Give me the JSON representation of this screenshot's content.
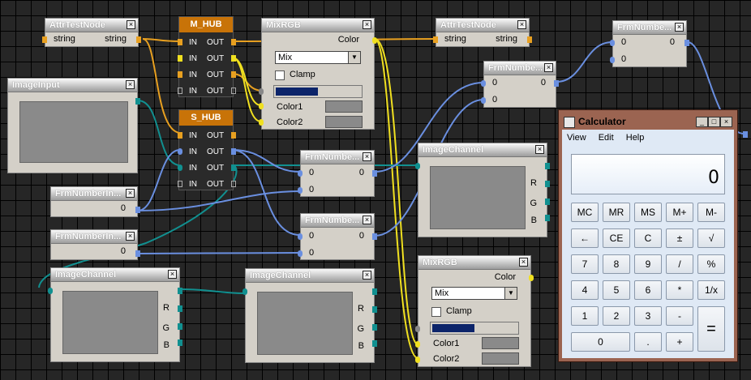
{
  "nodes": {
    "attr1": {
      "title": "AttrTestNode",
      "in_label": "string",
      "out_label": "string"
    },
    "attr2": {
      "title": "AttrTestNode",
      "in_label": "string",
      "out_label": "string"
    },
    "m_hub": {
      "title": "M_HUB",
      "rows": [
        {
          "in": "IN",
          "out": "OUT"
        },
        {
          "in": "IN",
          "out": "OUT"
        },
        {
          "in": "IN",
          "out": "OUT"
        },
        {
          "in": "IN",
          "out": "OUT"
        }
      ]
    },
    "s_hub": {
      "title": "S_HUB",
      "rows": [
        {
          "in": "IN",
          "out": "OUT"
        },
        {
          "in": "IN",
          "out": "OUT"
        },
        {
          "in": "IN",
          "out": "OUT"
        },
        {
          "in": "IN",
          "out": "OUT"
        }
      ]
    },
    "mix1": {
      "title": "MixRGB",
      "out_label": "Color",
      "mode": "Mix",
      "clamp_label": "Clamp",
      "fac": 0.5,
      "color1_label": "Color1",
      "color2_label": "Color2"
    },
    "mix2": {
      "title": "MixRGB",
      "out_label": "Color",
      "mode": "Mix",
      "clamp_label": "Clamp",
      "fac": 0.5,
      "color1_label": "Color1",
      "color2_label": "Color2"
    },
    "image_input": {
      "title": "ImageInput"
    },
    "frm_top": {
      "title": "FrmNumbe...",
      "in_value": "0",
      "out_value": "0",
      "in2_value": "0"
    },
    "frm_a": {
      "title": "FrmNumbe...",
      "in_value": "0",
      "out_value": "0",
      "in2_value": "0"
    },
    "frm_b": {
      "title": "FrmNumbe...",
      "in_value": "0",
      "out_value": "0",
      "in2_value": "0"
    },
    "frm_c": {
      "title": "FrmNumbe...",
      "in_value": "0",
      "out_value": "0",
      "in2_value": "0"
    },
    "frm_in1": {
      "title": "FrmNumberIn...",
      "value": "0"
    },
    "frm_in2": {
      "title": "FrmNumberIn...",
      "value": "0"
    },
    "ic_mid": {
      "title": "ImageChannel",
      "r": "R",
      "g": "G",
      "b": "B"
    },
    "ic_left": {
      "title": "ImageChannel",
      "r": "R",
      "g": "G",
      "b": "B"
    },
    "ic_center": {
      "title": "ImageChannel",
      "r": "R",
      "g": "G",
      "b": "B"
    }
  },
  "colors": {
    "string_port": "#e8a020",
    "color_port": "#f0e020",
    "number_port": "#6a8fe0",
    "image_port": "#119090",
    "hub": "#c87308"
  },
  "calculator": {
    "title": "Calculator",
    "menu": [
      "View",
      "Edit",
      "Help"
    ],
    "display": "0",
    "keys": [
      [
        "MC",
        "MR",
        "MS",
        "M+",
        "M-"
      ],
      [
        "←",
        "CE",
        "C",
        "±",
        "√"
      ],
      [
        "7",
        "8",
        "9",
        "/",
        "%"
      ],
      [
        "4",
        "5",
        "6",
        "*",
        "1/x"
      ],
      [
        "1",
        "2",
        "3",
        "-",
        "="
      ],
      [
        "0",
        ".",
        "+"
      ]
    ]
  }
}
